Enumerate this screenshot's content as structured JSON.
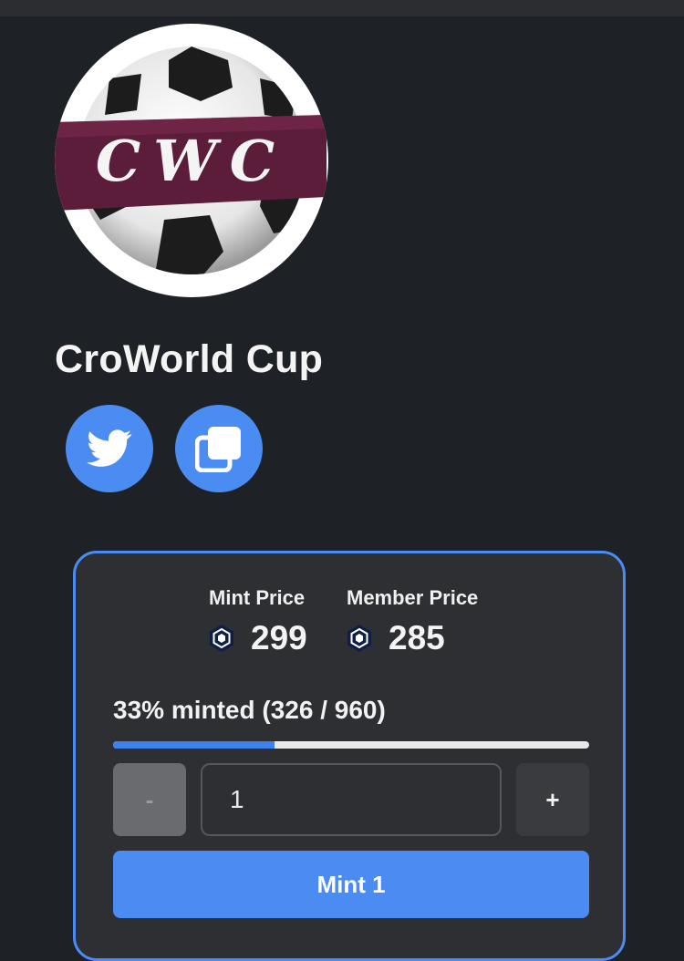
{
  "collection": {
    "logo_text": "CWC",
    "title": "CroWorld Cup"
  },
  "social": {
    "twitter_icon": "twitter-icon",
    "copy_icon": "copy-icon",
    "accent": "#4b8cf2"
  },
  "mint": {
    "mint_price_label": "Mint Price",
    "mint_price_value": "299",
    "member_price_label": "Member Price",
    "member_price_value": "285",
    "currency_icon": "cronos-icon",
    "progress_text": "33% minted (326 / 960)",
    "minted_fraction": 0.34,
    "minus_label": "-",
    "quantity_value": "1",
    "plus_label": "+",
    "mint_button_label": "Mint 1"
  }
}
